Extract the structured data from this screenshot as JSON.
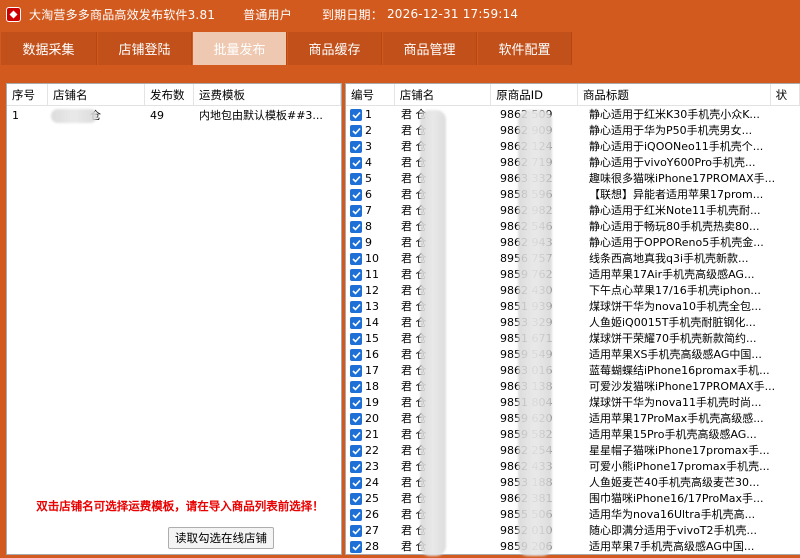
{
  "window": {
    "title": "大淘营多多商品高效发布软件3.81",
    "user_type": "普通用户",
    "expiry_label": "到期日期：",
    "expiry_value": "2026-12-31 17:59:14"
  },
  "tabs": [
    {
      "label": "数据采集",
      "active": false
    },
    {
      "label": "店铺登陆",
      "active": false
    },
    {
      "label": "批量发布",
      "active": true
    },
    {
      "label": "商品缓存",
      "active": false
    },
    {
      "label": "商品管理",
      "active": false
    },
    {
      "label": "软件配置",
      "active": false
    }
  ],
  "store_table": {
    "headers": [
      "序号",
      "店铺名",
      "发布数",
      "运费模板"
    ],
    "rows": [
      {
        "no": "1",
        "name": "仓",
        "count": "49",
        "template": "内地包由默认模板##3..."
      }
    ],
    "notice": "双击店铺名可选择运费模板，请在导入商品列表前选择！",
    "button_label": "读取勾选在线店铺"
  },
  "product_table": {
    "headers": [
      "编号",
      "店铺名",
      "原商品ID",
      "商品标题",
      "状"
    ],
    "rows": [
      {
        "no": "1",
        "store": "君 仓",
        "pid": "9862 509",
        "title": "静心适用于红米K30手机壳小众K..."
      },
      {
        "no": "2",
        "store": "君 仓",
        "pid": "9862 909",
        "title": "静心适用于华为P50手机壳男女..."
      },
      {
        "no": "3",
        "store": "君 仓",
        "pid": "9862 124",
        "title": "静心适用于iQOONeo11手机壳个..."
      },
      {
        "no": "4",
        "store": "君 仓",
        "pid": "9862 719",
        "title": "静心适用于vivoY600Pro手机壳..."
      },
      {
        "no": "5",
        "store": "君 仓",
        "pid": "9863 332",
        "title": "趣味很多猫咪iPhone17PROMAX手..."
      },
      {
        "no": "6",
        "store": "君 仓",
        "pid": "9858 596",
        "title": "【联想】异能者适用苹果17prom..."
      },
      {
        "no": "7",
        "store": "君 仓",
        "pid": "9862 982",
        "title": "静心适用于红米Note11手机壳耐..."
      },
      {
        "no": "8",
        "store": "君 仓",
        "pid": "9862 546",
        "title": "静心适用于畅玩80手机壳热卖80..."
      },
      {
        "no": "9",
        "store": "君 仓",
        "pid": "9862 943",
        "title": "静心适用于OPPOReno5手机壳金..."
      },
      {
        "no": "10",
        "store": "君 仓",
        "pid": "8956 757",
        "title": "线条西高地真我q3i手机壳新款..."
      },
      {
        "no": "11",
        "store": "君 仓",
        "pid": "9859 762",
        "title": "适用苹果17Air手机壳高级感AG..."
      },
      {
        "no": "12",
        "store": "君 仓",
        "pid": "9862 430",
        "title": "下午点心苹果17/16手机壳iphon..."
      },
      {
        "no": "13",
        "store": "君 仓",
        "pid": "9851 939",
        "title": "煤球饼干华为nova10手机壳全包..."
      },
      {
        "no": "14",
        "store": "君 仓",
        "pid": "9853 329",
        "title": "人鱼姬iQ0015T手机壳耐脏钢化..."
      },
      {
        "no": "15",
        "store": "君 仓",
        "pid": "9851 671",
        "title": "煤球饼干荣耀70手机壳新款简约..."
      },
      {
        "no": "16",
        "store": "君 仓",
        "pid": "9859 549",
        "title": "适用苹果XS手机壳高级感AG中国..."
      },
      {
        "no": "17",
        "store": "君 仓",
        "pid": "9863 016",
        "title": "蓝莓蝴蝶结iPhone16promax手机..."
      },
      {
        "no": "18",
        "store": "君 仓",
        "pid": "9863 138",
        "title": "可爱沙发猫咪iPhone17PROMAX手..."
      },
      {
        "no": "19",
        "store": "君 仓",
        "pid": "9851 804",
        "title": "煤球饼干华为nova11手机壳时尚..."
      },
      {
        "no": "20",
        "store": "君 仓",
        "pid": "9859 620",
        "title": "适用苹果17ProMax手机壳高级感..."
      },
      {
        "no": "21",
        "store": "君 仓",
        "pid": "9859 582",
        "title": "适用苹果15Pro手机壳高级感AG..."
      },
      {
        "no": "22",
        "store": "君 仓",
        "pid": "9862 254",
        "title": "星星帽子猫咪iPhone17promax手..."
      },
      {
        "no": "23",
        "store": "君 仓",
        "pid": "9862 433",
        "title": "可爱小熊iPhone17promax手机壳..."
      },
      {
        "no": "24",
        "store": "君 仓",
        "pid": "9853 188",
        "title": "人鱼姬麦芒40手机壳高级麦芒30..."
      },
      {
        "no": "25",
        "store": "君 仓",
        "pid": "9862 381",
        "title": "围巾猫咪iPhone16/17ProMax手..."
      },
      {
        "no": "26",
        "store": "君 仓",
        "pid": "9855 506",
        "title": "适用华为nova16Ultra手机壳高..."
      },
      {
        "no": "27",
        "store": "君 仓",
        "pid": "9852 010",
        "title": "随心即满分适用于vivoT2手机壳..."
      },
      {
        "no": "28",
        "store": "君 仓",
        "pid": "9859 206",
        "title": "适用苹果7手机壳高级感AG中国..."
      }
    ]
  },
  "colors": {
    "window_bg": "#d25a1e",
    "tab_bg": "#c2501b",
    "tab_active_bg": "#eec8b0",
    "checkbox": "#1e6fd6",
    "notice": "#e80000"
  }
}
